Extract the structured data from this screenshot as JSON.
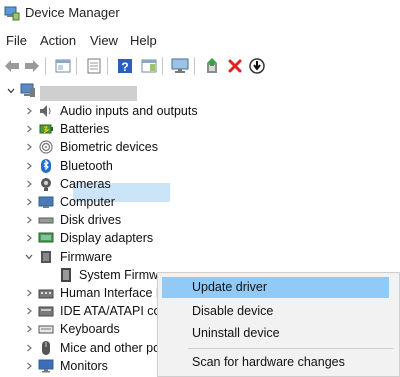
{
  "window": {
    "title": "Device Manager"
  },
  "menu": [
    "File",
    "Action",
    "View",
    "Help"
  ],
  "toolbar": {
    "buttons": [
      "back-arrow-icon",
      "forward-arrow-icon",
      "properties-icon",
      "show-hidden-icon",
      "help-icon",
      "action-pane-icon",
      "monitor-scan-icon",
      "update-driver-icon",
      "uninstall-x-icon",
      "disable-down-arrow-icon"
    ]
  },
  "tree": {
    "root_name": "",
    "categories": [
      {
        "label": "Audio inputs and outputs",
        "icon": "speaker-icon",
        "expanded": false
      },
      {
        "label": "Batteries",
        "icon": "battery-icon",
        "expanded": false
      },
      {
        "label": "Biometric devices",
        "icon": "fingerprint-icon",
        "expanded": false
      },
      {
        "label": "Bluetooth",
        "icon": "bluetooth-icon",
        "expanded": false
      },
      {
        "label": "Cameras",
        "icon": "camera-icon",
        "expanded": false
      },
      {
        "label": "Computer",
        "icon": "computer-icon",
        "expanded": false
      },
      {
        "label": "Disk drives",
        "icon": "disk-drive-icon",
        "expanded": false
      },
      {
        "label": "Display adapters",
        "icon": "display-adapter-icon",
        "expanded": false
      },
      {
        "label": "Firmware",
        "icon": "firmware-icon",
        "expanded": true
      },
      {
        "label": "System Firmwa",
        "icon": "firmware-chip-icon",
        "child": true,
        "selected": true
      },
      {
        "label": "Human Interface D",
        "icon": "hid-icon",
        "expanded": false
      },
      {
        "label": "IDE ATA/ATAPI cont",
        "icon": "ide-controller-icon",
        "expanded": false
      },
      {
        "label": "Keyboards",
        "icon": "keyboard-icon",
        "expanded": false
      },
      {
        "label": "Mice and other po",
        "icon": "mouse-icon",
        "expanded": false
      },
      {
        "label": "Monitors",
        "icon": "monitor-icon",
        "expanded": false
      }
    ]
  },
  "context_menu": {
    "update": "Update driver",
    "disable": "Disable device",
    "uninstall": "Uninstall device",
    "scan": "Scan for hardware changes"
  },
  "colors": {
    "selection": "#cce4f7",
    "menu_hover": "#91c9f7",
    "menu_bg": "#f2f2f2",
    "uninstall_red": "#e02020",
    "help_blue": "#2b5fbf"
  }
}
